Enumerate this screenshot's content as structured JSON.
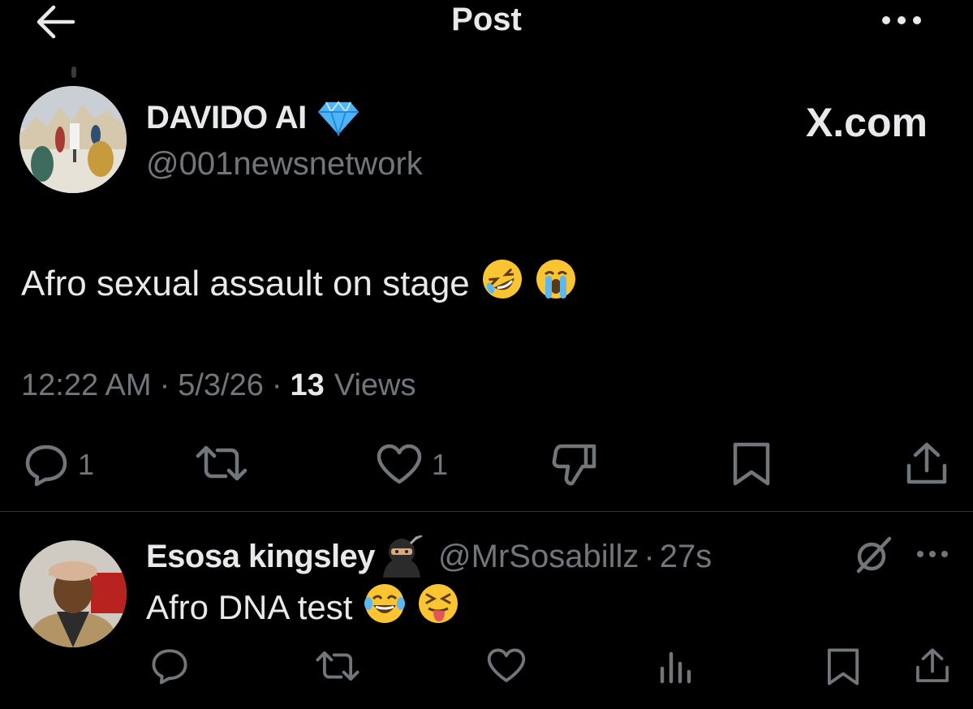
{
  "header": {
    "title": "Post",
    "back_icon": "arrow-left-icon",
    "more_icon": "more-horizontal-icon"
  },
  "post": {
    "display_name": "DAVIDO AI",
    "verified_icon": "gem-icon",
    "handle": "@001newsnetwork",
    "watermark": "X.com",
    "text": "Afro sexual assault on stage",
    "emojis": [
      "rolling-on-floor-laughing-emoji",
      "loudly-crying-emoji"
    ],
    "time": "12:22 AM",
    "date": "5/3/26",
    "views_count": "13",
    "views_label": "Views",
    "actions": {
      "reply_count": "1",
      "repost_count": "",
      "like_count": "1"
    }
  },
  "reply": {
    "display_name": "Esosa kingsley",
    "name_emoji": "ninja-emoji",
    "handle": "@MrSosabillz",
    "separator": "·",
    "time": "27s",
    "text": "Afro DNA test",
    "emojis": [
      "face-with-tears-of-joy-emoji",
      "squinting-face-with-tongue-emoji"
    ]
  },
  "colors": {
    "background": "#000000",
    "primary_text": "#e7e9ea",
    "secondary_text": "#71767b",
    "divider": "#2f3336",
    "gem": "#4fb4f5"
  }
}
